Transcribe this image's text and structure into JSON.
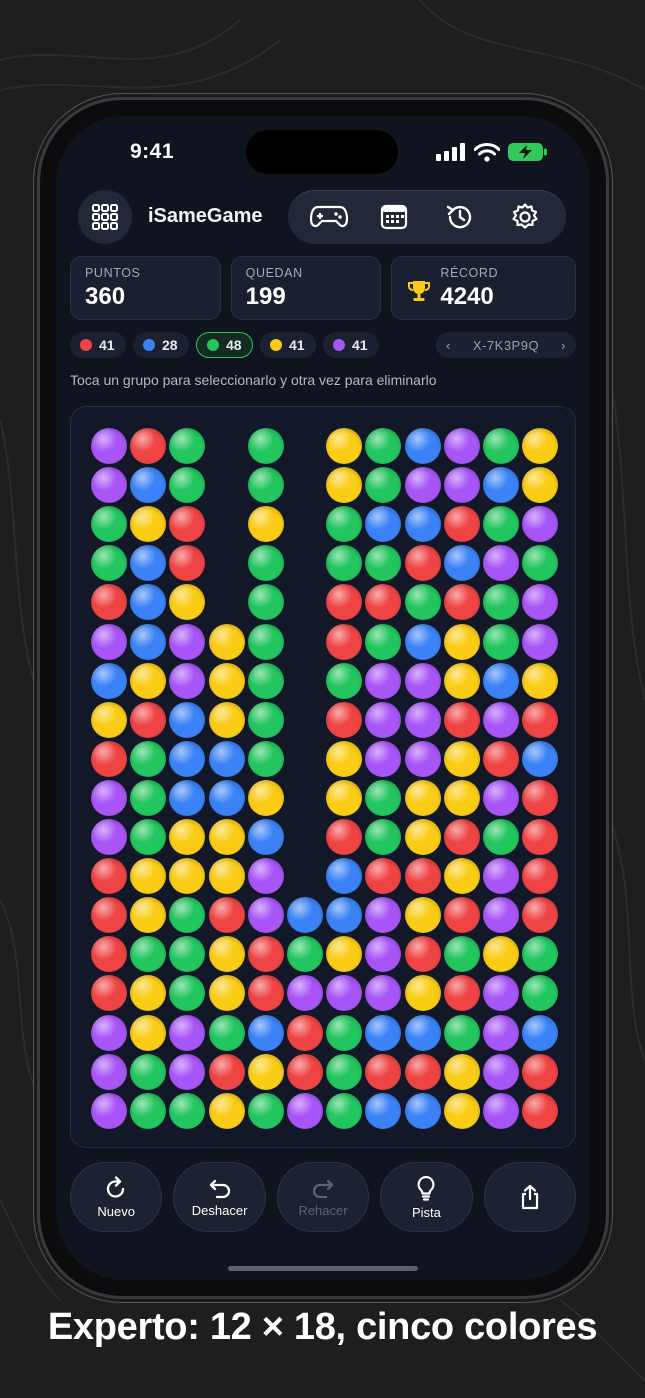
{
  "status_bar": {
    "time": "9:41"
  },
  "header": {
    "app_name": "iSameGame",
    "toolbar_icons": [
      "gamepad-icon",
      "calendar-icon",
      "history-icon",
      "gear-icon"
    ]
  },
  "stats": [
    {
      "label": "PUNTOS",
      "value": "360"
    },
    {
      "label": "QUEDAN",
      "value": "199"
    },
    {
      "label": "RÉCORD",
      "value": "4240"
    }
  ],
  "color_counts": [
    {
      "color": "#ef4444",
      "count": "41",
      "active": false
    },
    {
      "color": "#3b82f6",
      "count": "28",
      "active": false
    },
    {
      "color": "#22c55e",
      "count": "48",
      "active": true
    },
    {
      "color": "#facc15",
      "count": "41",
      "active": false
    },
    {
      "color": "#a855f7",
      "count": "41",
      "active": false
    }
  ],
  "seed": "X-7K3P9Q",
  "hint": "Toca un grupo para seleccionarlo y otra vez para eliminarlo",
  "board": {
    "columns": 12,
    "rows": 18,
    "colors": {
      "R": "#ef4444",
      "B": "#3b82f6",
      "G": "#22c55e",
      "Y": "#facc15",
      "P": "#a855f7"
    },
    "grid": [
      "PRG.G.YGBPGY",
      "PBG.G.YGPPBY",
      "GYR.Y.GBBRGP",
      "GBR.G.GGRBPG",
      "RBY.G.RRGRGP",
      "PBPYG.RGBYGP",
      "BYPYG.GPPYBY",
      "YRBYG.RPPRPR",
      "RGBBG.YPPYRB",
      "PGBBY.YGYYPR",
      "PGYYB.RGYRGR",
      "RYYYP.BRRYPR",
      "RYGRPBBPYRPR",
      "RGGYRGYPRGYG",
      "RYGYRPPPYRPG",
      "PYPGBRGBBGPB",
      "PGPRYRGRRYPR",
      "PGGYGPGBBYPR"
    ]
  },
  "actions": [
    {
      "label": "Nuevo",
      "enabled": true
    },
    {
      "label": "Deshacer",
      "enabled": true
    },
    {
      "label": "Rehacer",
      "enabled": false
    },
    {
      "label": "Pista",
      "enabled": true
    }
  ],
  "caption": "Experto: 12 × 18, cinco colores"
}
